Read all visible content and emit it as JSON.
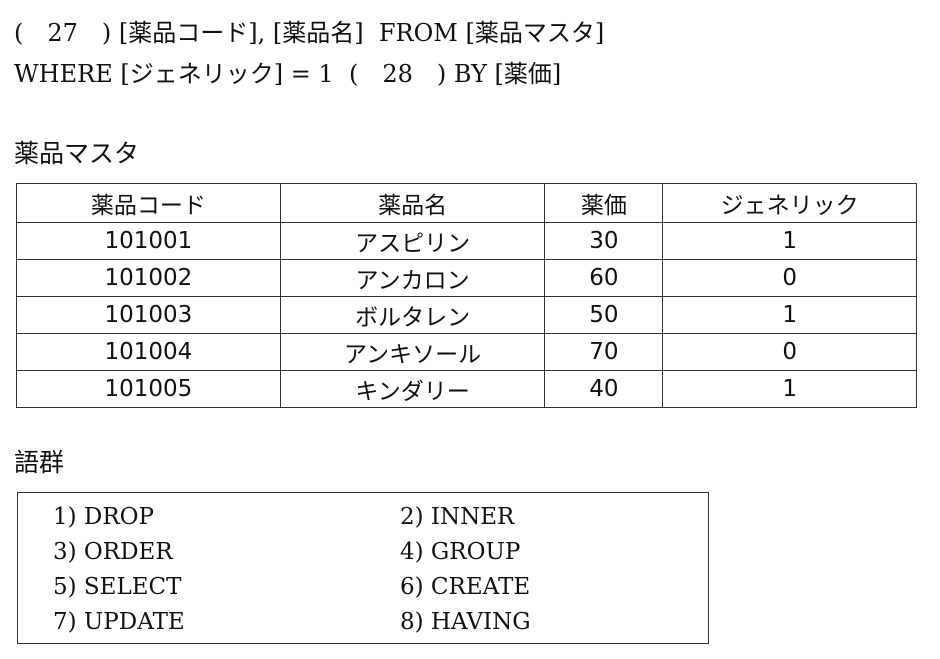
{
  "question": {
    "line1": "(　27　) [薬品コード], [薬品名]  FROM [薬品マスタ]",
    "line2": "WHERE [ジェネリック] = 1  (　28　) BY [薬価]"
  },
  "master_table": {
    "title": "薬品マスタ",
    "headers": [
      "薬品コード",
      "薬品名",
      "薬価",
      "ジェネリック"
    ],
    "rows": [
      [
        "101001",
        "アスピリン",
        "30",
        "1"
      ],
      [
        "101002",
        "アンカロン",
        "60",
        "0"
      ],
      [
        "101003",
        "ボルタレン",
        "50",
        "1"
      ],
      [
        "101004",
        "アンキソール",
        "70",
        "0"
      ],
      [
        "101005",
        "キンダリー",
        "40",
        "1"
      ]
    ]
  },
  "term_group": {
    "title": "語群",
    "items": [
      "1) DROP",
      "2) INNER",
      "3) ORDER",
      "4) GROUP",
      "5) SELECT",
      "6) CREATE",
      "7) UPDATE",
      "8) HAVING"
    ]
  }
}
